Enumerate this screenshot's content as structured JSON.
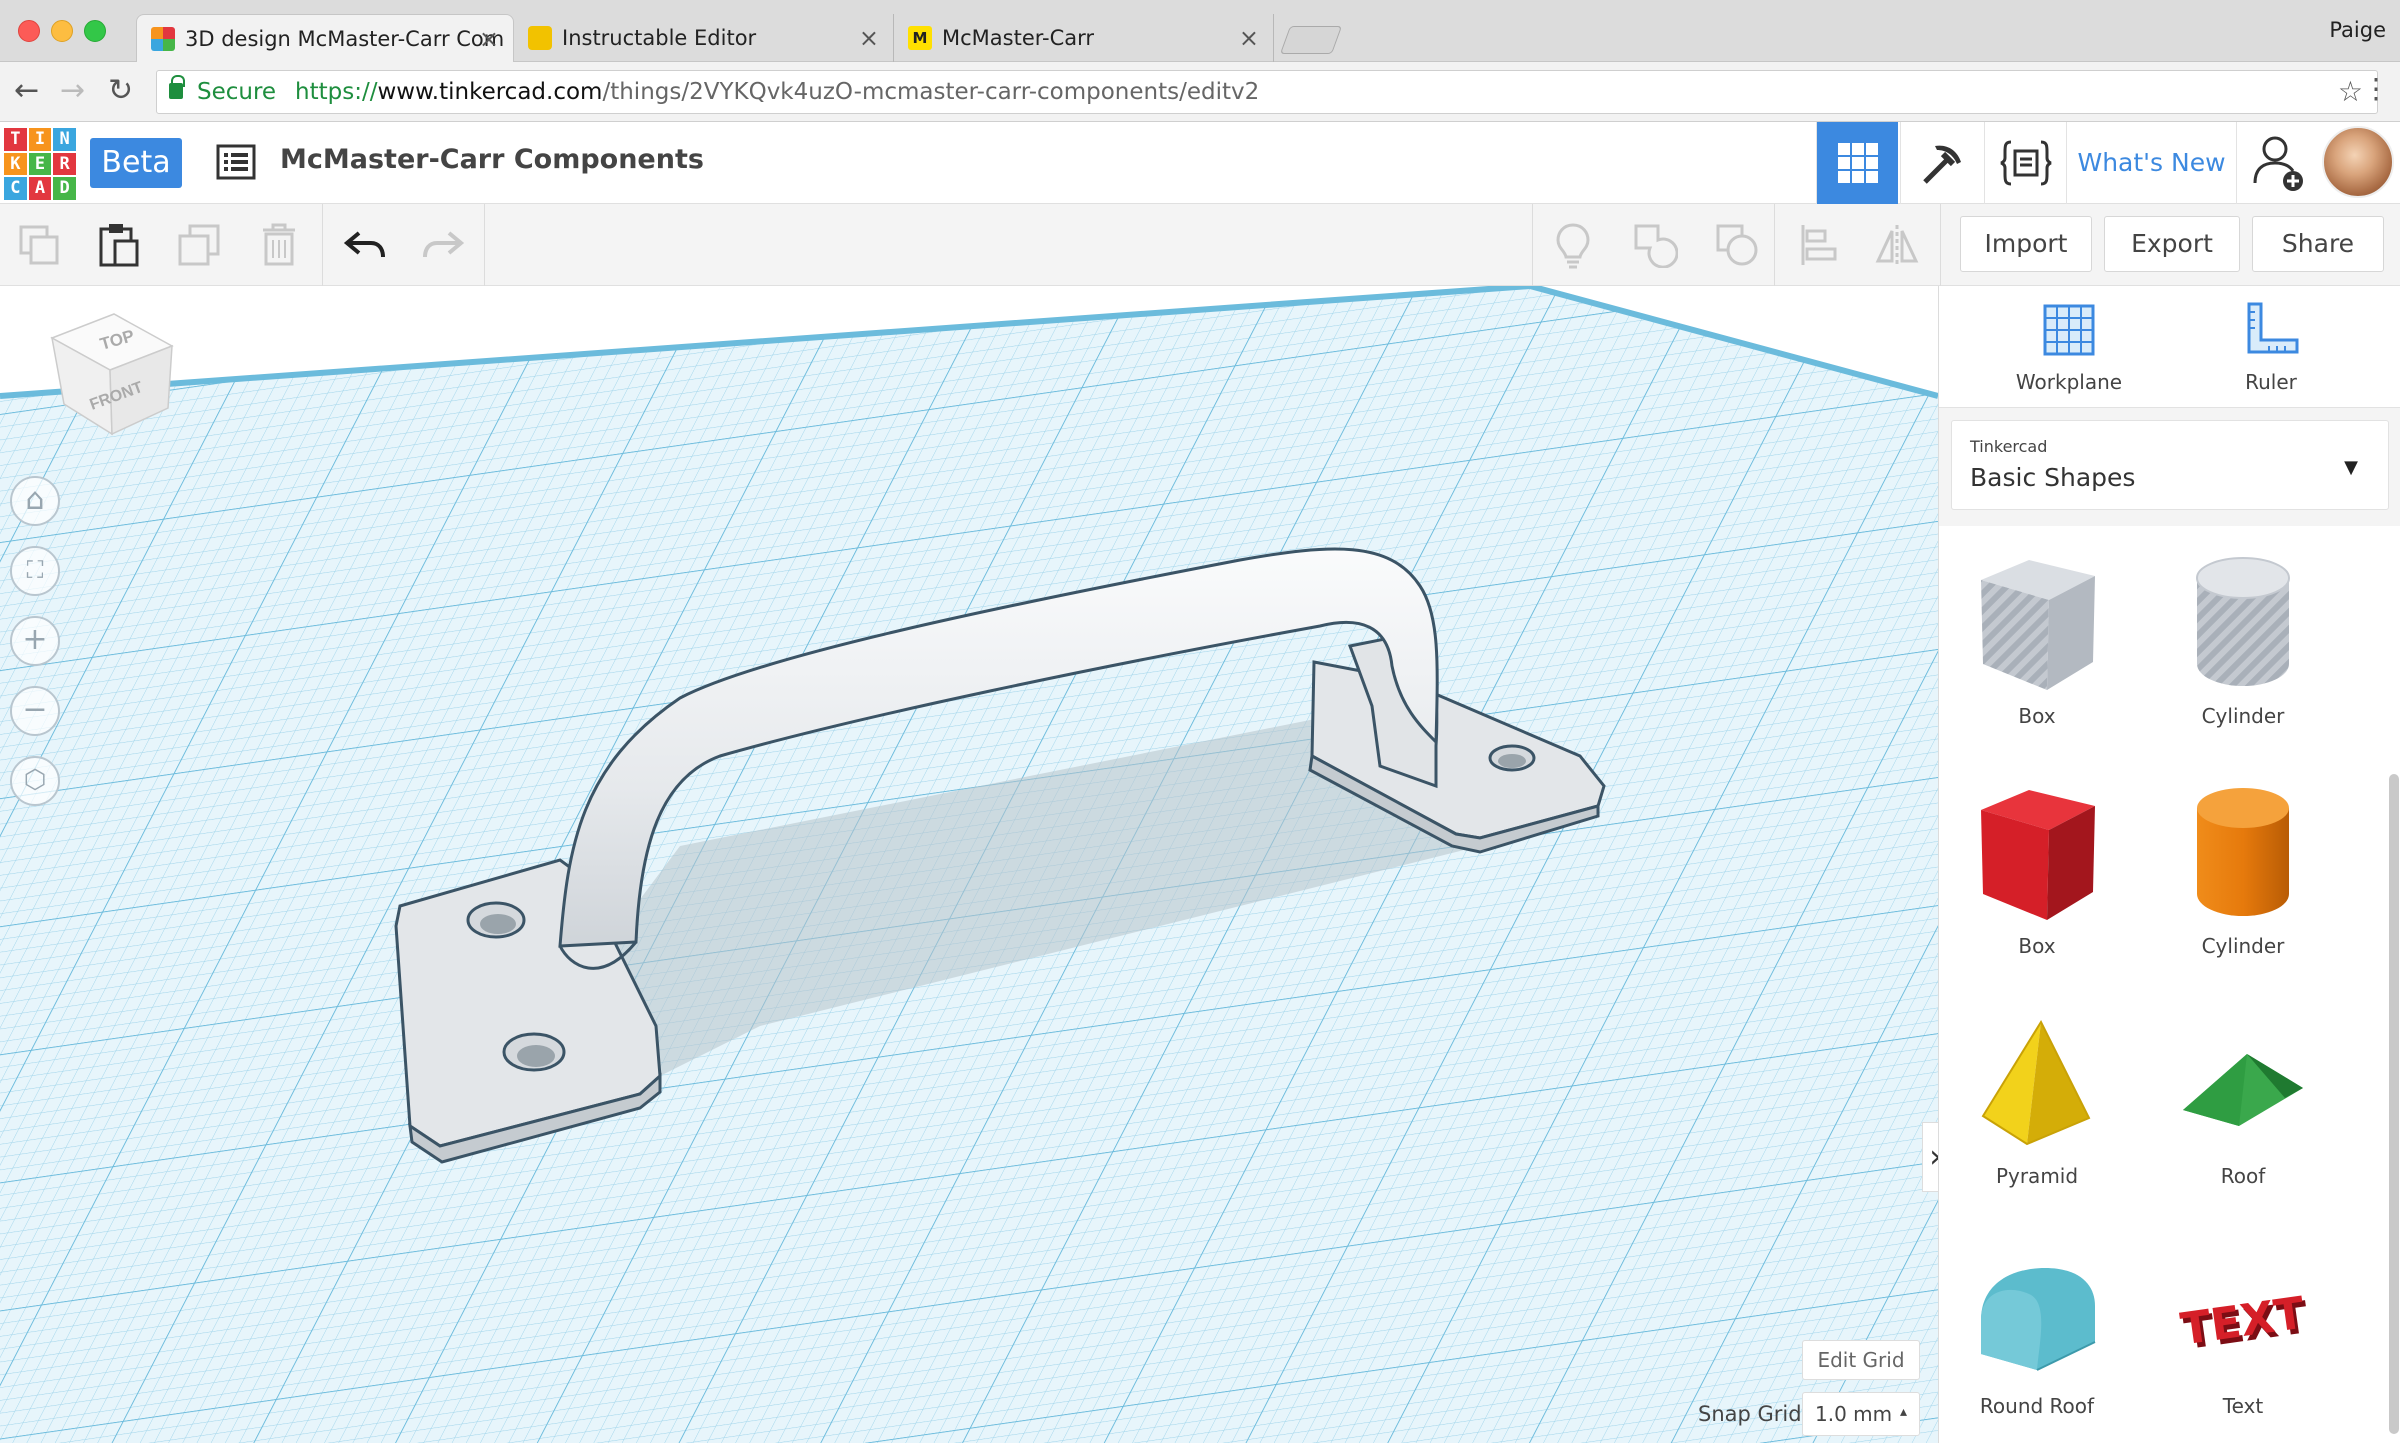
{
  "browser": {
    "tabs": [
      {
        "title": "3D design McMaster-Carr Com",
        "active": true
      },
      {
        "title": "Instructable Editor",
        "active": false
      },
      {
        "title": "McMaster-Carr",
        "active": false
      }
    ],
    "user": "Paige",
    "secure_label": "Secure",
    "url_scheme": "https://",
    "url_host": "www.tinkercad.com",
    "url_path": "/things/2VYKQvk4uzO-mcmaster-carr-components/editv2"
  },
  "app": {
    "logo_letters": [
      "T",
      "I",
      "N",
      "K",
      "E",
      "R",
      "C",
      "A",
      "D"
    ],
    "beta_label": "Beta",
    "design_title": "McMaster-Carr Components",
    "whats_new": "What's New",
    "colors": {
      "accent": "#3c89e0",
      "logo": [
        "#e2373f",
        "#f7941d",
        "#3aa6df",
        "#f7941d",
        "#46b648",
        "#e2373f",
        "#3aa6df",
        "#e2373f",
        "#46b648"
      ]
    }
  },
  "toolbar": {
    "import_label": "Import",
    "export_label": "Export",
    "share_label": "Share"
  },
  "viewport": {
    "viewcube_top": "TOP",
    "viewcube_front": "FRONT",
    "edit_grid_label": "Edit Grid",
    "snap_grid_label": "Snap Grid",
    "snap_grid_value": "1.0 mm"
  },
  "panel": {
    "workplane_label": "Workplane",
    "ruler_label": "Ruler",
    "library_vendor": "Tinkercad",
    "library_name": "Basic Shapes",
    "shapes": [
      {
        "label": "Box",
        "icon": "box-hole-icon"
      },
      {
        "label": "Cylinder",
        "icon": "cylinder-hole-icon"
      },
      {
        "label": "Box",
        "icon": "box-red-icon"
      },
      {
        "label": "Cylinder",
        "icon": "cylinder-orange-icon"
      },
      {
        "label": "Pyramid",
        "icon": "pyramid-icon"
      },
      {
        "label": "Roof",
        "icon": "roof-icon"
      },
      {
        "label": "Round Roof",
        "icon": "round-roof-icon"
      },
      {
        "label": "Text",
        "icon": "text-shape-icon",
        "shape_text": "TEXT"
      }
    ]
  }
}
